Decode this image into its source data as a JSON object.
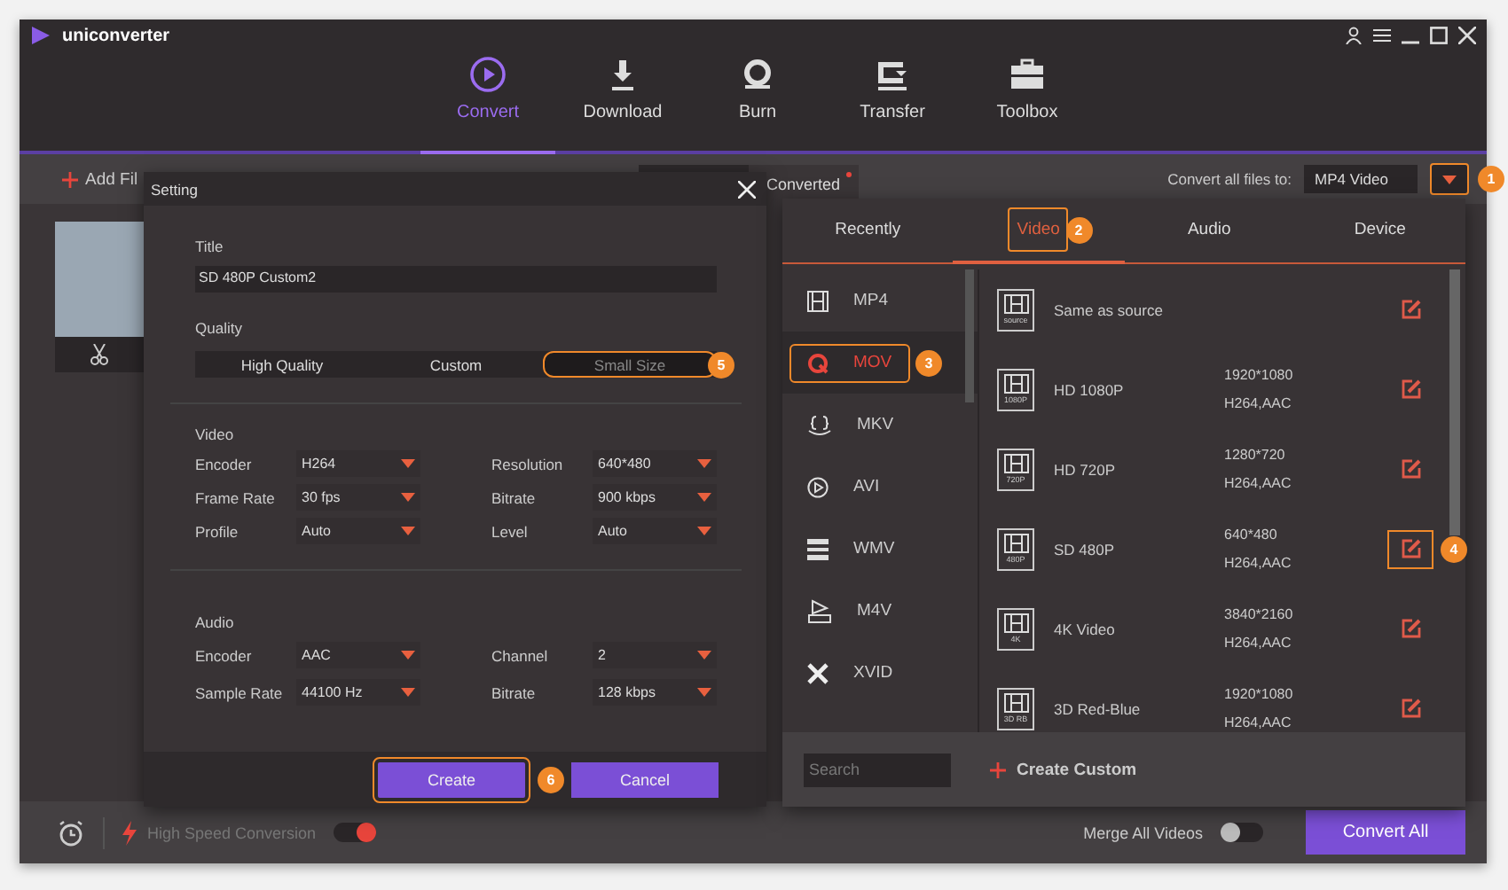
{
  "app": {
    "name": "uniconverter"
  },
  "nav": [
    {
      "label": "Convert",
      "selected": true
    },
    {
      "label": "Download",
      "selected": false
    },
    {
      "label": "Burn",
      "selected": false
    },
    {
      "label": "Transfer",
      "selected": false
    },
    {
      "label": "Toolbox",
      "selected": false
    }
  ],
  "toolbar": {
    "add_files": "Add Fil",
    "converted_tab": "Converted",
    "converted_has_dot": true,
    "convert_to_label": "Convert all files to:",
    "convert_to_value": "MP4 Video",
    "dropdown_callout": "1"
  },
  "bottom": {
    "high_speed": "High Speed Conversion",
    "high_speed_on": true,
    "merge": "Merge All Videos",
    "merge_on": false,
    "convert_all": "Convert All"
  },
  "setting": {
    "title": "Setting",
    "title_label": "Title",
    "title_value": "SD 480P  Custom2",
    "quality_label": "Quality",
    "quality_options": [
      {
        "label": "High Quality",
        "selected": false
      },
      {
        "label": "Custom",
        "selected": false
      },
      {
        "label": "Small Size",
        "selected": true,
        "callout": "5"
      }
    ],
    "video": {
      "heading": "Video",
      "fields": [
        {
          "label": "Encoder",
          "value": "H264"
        },
        {
          "label": "Resolution",
          "value": "640*480"
        },
        {
          "label": "Frame Rate",
          "value": "30 fps"
        },
        {
          "label": "Bitrate",
          "value": "900 kbps"
        },
        {
          "label": "Profile",
          "value": "Auto"
        },
        {
          "label": "Level",
          "value": "Auto"
        }
      ]
    },
    "audio": {
      "heading": "Audio",
      "fields": [
        {
          "label": "Encoder",
          "value": "AAC"
        },
        {
          "label": "Channel",
          "value": "2"
        },
        {
          "label": "Sample Rate",
          "value": "44100 Hz"
        },
        {
          "label": "Bitrate",
          "value": "128 kbps"
        }
      ]
    },
    "buttons": [
      {
        "label": "Create",
        "callout": "6"
      },
      {
        "label": "Cancel"
      }
    ]
  },
  "formats": {
    "tabs": [
      {
        "label": "Recently",
        "selected": false
      },
      {
        "label": "Video",
        "selected": true,
        "callout": "2"
      },
      {
        "label": "Audio",
        "selected": false
      },
      {
        "label": "Device",
        "selected": false
      }
    ],
    "list": [
      {
        "label": "MP4",
        "selected": false
      },
      {
        "label": "MOV",
        "selected": true,
        "callout": "3"
      },
      {
        "label": "MKV",
        "selected": false
      },
      {
        "label": "AVI",
        "selected": false
      },
      {
        "label": "WMV",
        "selected": false
      },
      {
        "label": "M4V",
        "selected": false
      },
      {
        "label": "XVID",
        "selected": false
      }
    ],
    "presets": [
      {
        "name": "Same as source",
        "badge": "source"
      },
      {
        "name": "HD 1080P",
        "badge": "1080P",
        "resolution": "1920*1080",
        "codec": "H264,AAC"
      },
      {
        "name": "HD 720P",
        "badge": "720P",
        "resolution": "1280*720",
        "codec": "H264,AAC"
      },
      {
        "name": "SD 480P",
        "badge": "480P",
        "resolution": "640*480",
        "codec": "H264,AAC",
        "callout": "4"
      },
      {
        "name": "4K Video",
        "badge": "4K",
        "resolution": "3840*2160",
        "codec": "H264,AAC"
      },
      {
        "name": "3D Red-Blue",
        "badge": "3D RB",
        "resolution": "1920*1080",
        "codec": "H264,AAC"
      }
    ],
    "search_placeholder": "Search",
    "create_custom": "Create Custom"
  }
}
